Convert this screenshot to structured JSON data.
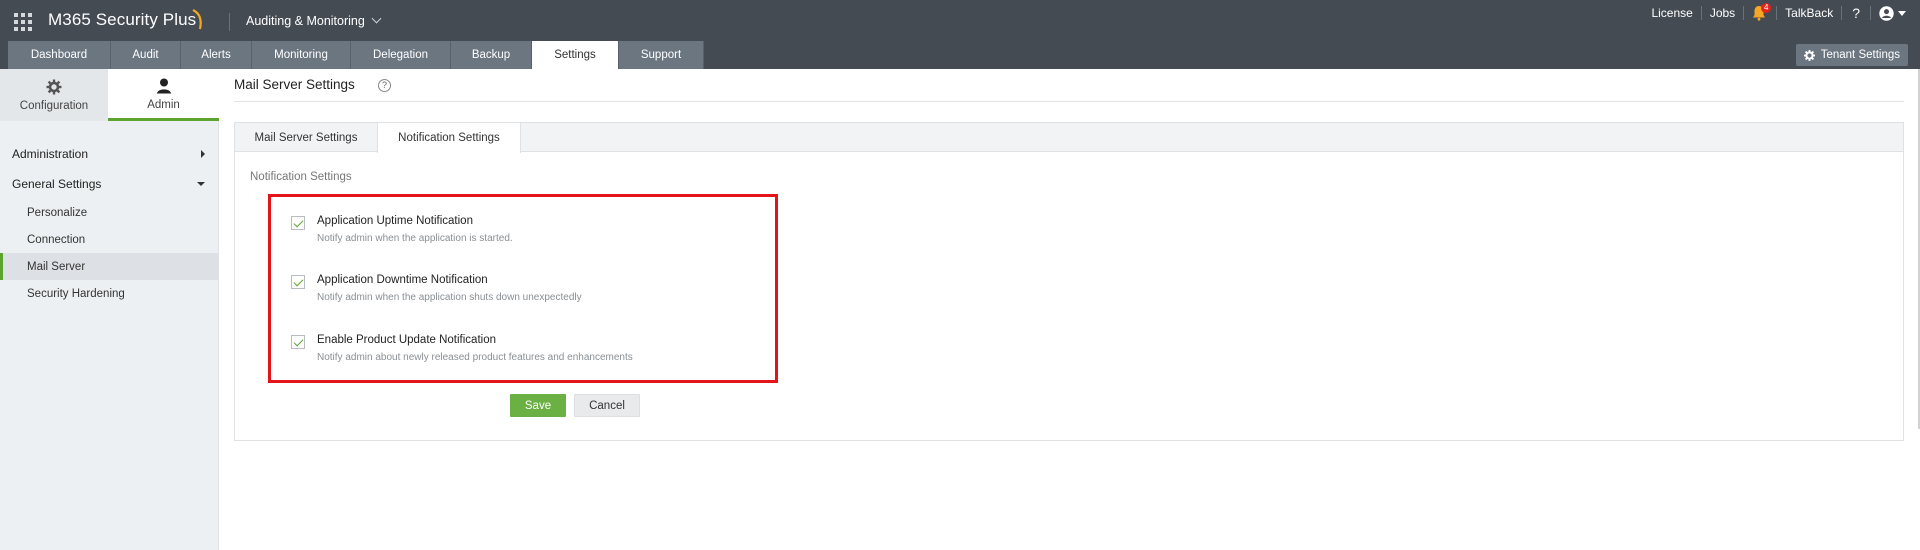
{
  "header": {
    "brand": "M365 Security Plus",
    "module": "Auditing & Monitoring",
    "links": [
      "License",
      "Jobs",
      "TalkBack"
    ],
    "notification_count": "4",
    "help_glyph": "?",
    "icons": [
      "apps-grid-icon",
      "bell-icon",
      "user-avatar-icon"
    ]
  },
  "tabs": [
    {
      "label": "Dashboard"
    },
    {
      "label": "Audit"
    },
    {
      "label": "Alerts"
    },
    {
      "label": "Monitoring"
    },
    {
      "label": "Delegation"
    },
    {
      "label": "Backup"
    },
    {
      "label": "Settings",
      "active": true
    },
    {
      "label": "Support"
    }
  ],
  "tenant_settings": "Tenant Settings",
  "sidebar": {
    "toggle": {
      "configuration": "Configuration",
      "admin": "Admin"
    },
    "sections": [
      {
        "label": "Administration",
        "expanded": false
      },
      {
        "label": "General Settings",
        "expanded": true
      }
    ],
    "items": [
      {
        "label": "Personalize"
      },
      {
        "label": "Connection"
      },
      {
        "label": "Mail Server",
        "active": true
      },
      {
        "label": "Security Hardening"
      }
    ]
  },
  "page": {
    "title": "Mail Server Settings",
    "help": "?"
  },
  "panel": {
    "tabs": [
      {
        "label": "Mail Server Settings"
      },
      {
        "label": "Notification Settings",
        "active": true
      }
    ],
    "section_label": "Notification Settings",
    "options": [
      {
        "title": "Application Uptime Notification",
        "description": "Notify admin when the application is started.",
        "checked": true
      },
      {
        "title": "Application Downtime Notification",
        "description": "Notify admin when the application shuts down unexpectedly",
        "checked": true
      },
      {
        "title": "Enable Product Update Notification",
        "description": "Notify admin about newly released product features and enhancements",
        "checked": true
      }
    ],
    "save": "Save",
    "cancel": "Cancel"
  },
  "colors": {
    "topbar": "#444b53",
    "tab": "#6c7680",
    "accent_green": "#6ab043",
    "highlight_red": "#e3151b"
  }
}
